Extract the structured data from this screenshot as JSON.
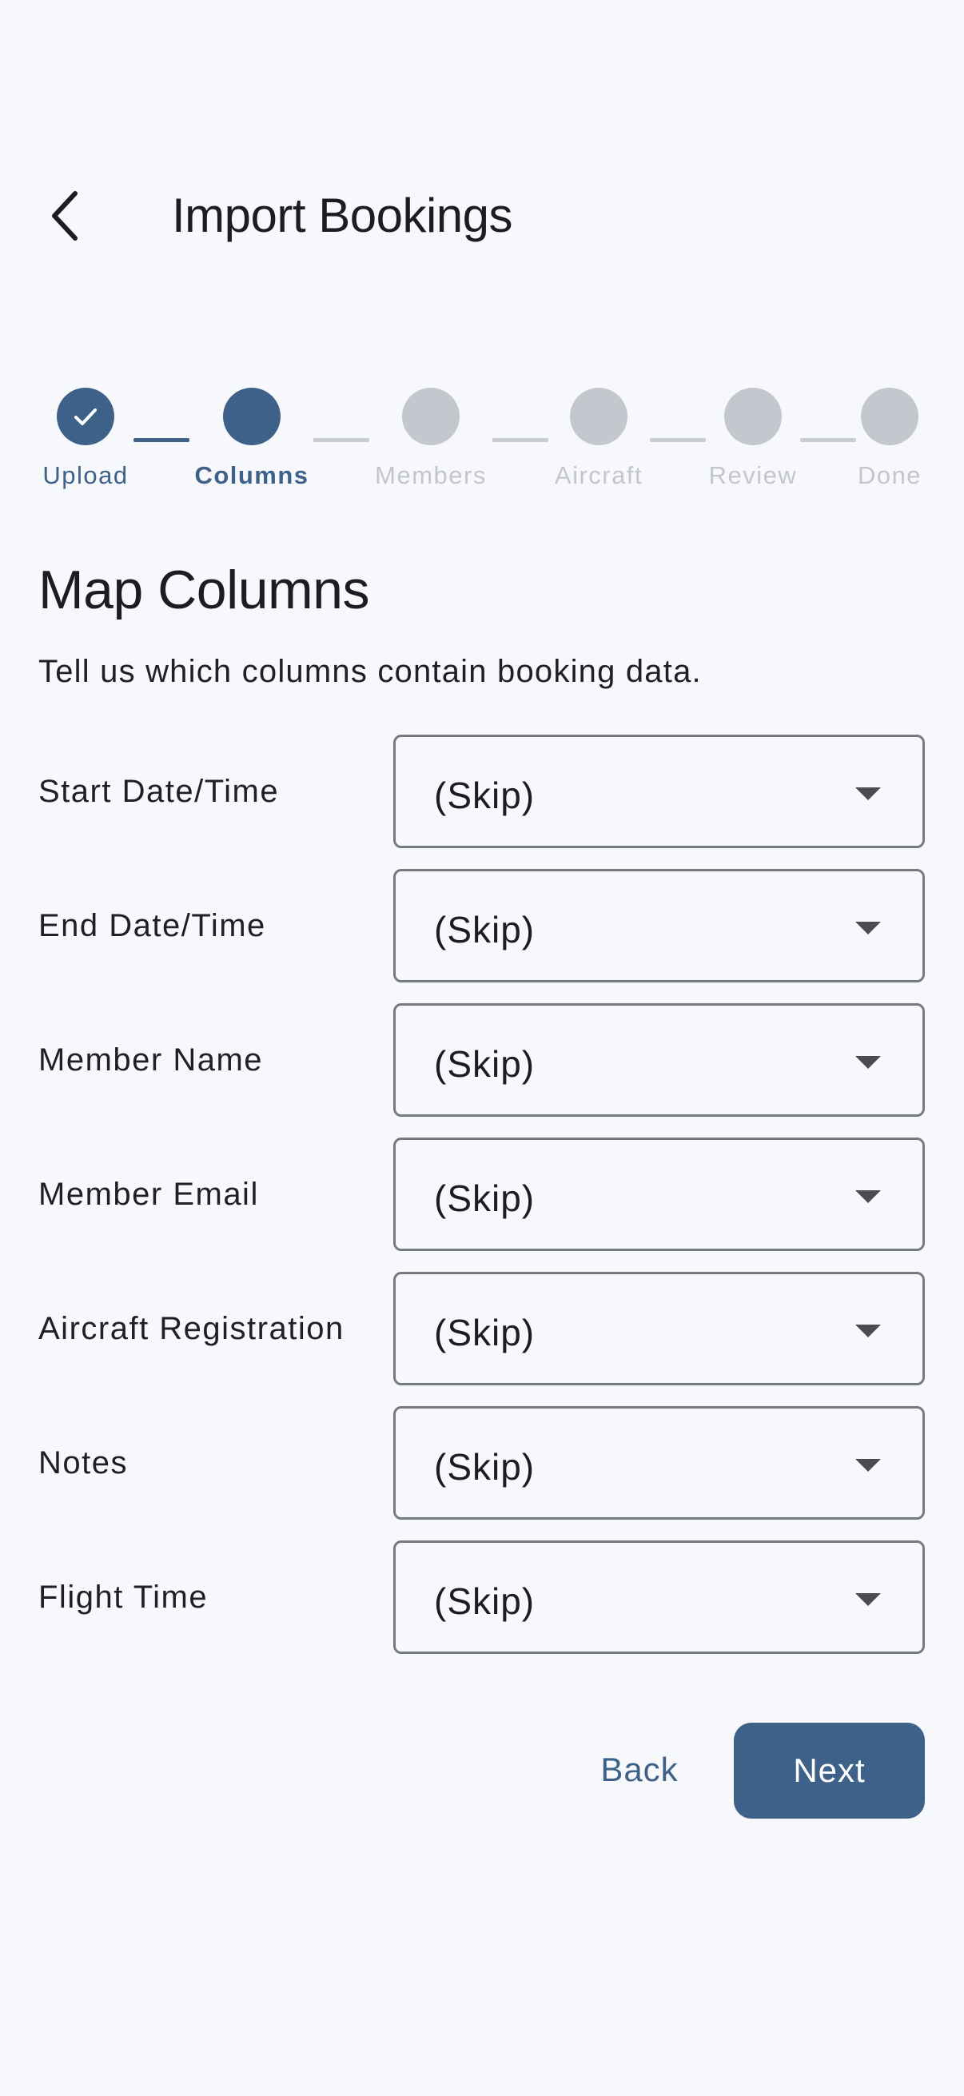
{
  "header": {
    "title": "Import Bookings",
    "back_icon": "chevron-left-icon"
  },
  "stepper": {
    "steps": [
      {
        "label": "Upload",
        "state": "done",
        "icon": "check-icon"
      },
      {
        "label": "Columns",
        "state": "active"
      },
      {
        "label": "Members",
        "state": "pending"
      },
      {
        "label": "Aircraft",
        "state": "pending"
      },
      {
        "label": "Review",
        "state": "pending"
      },
      {
        "label": "Done",
        "state": "pending"
      }
    ]
  },
  "main": {
    "title": "Map Columns",
    "description": "Tell us which columns contain booking data.",
    "mappings": [
      {
        "label": "Start Date/Time",
        "value": "(Skip)"
      },
      {
        "label": "End Date/Time",
        "value": "(Skip)"
      },
      {
        "label": "Member Name",
        "value": "(Skip)"
      },
      {
        "label": "Member Email",
        "value": "(Skip)"
      },
      {
        "label": "Aircraft Registration",
        "value": "(Skip)"
      },
      {
        "label": "Notes",
        "value": "(Skip)"
      },
      {
        "label": "Flight Time",
        "value": "(Skip)"
      }
    ]
  },
  "actions": {
    "back_label": "Back",
    "next_label": "Next"
  },
  "colors": {
    "primary": "#3e6189",
    "inactive": "#c4c8ce",
    "background": "#f7f8fc"
  }
}
